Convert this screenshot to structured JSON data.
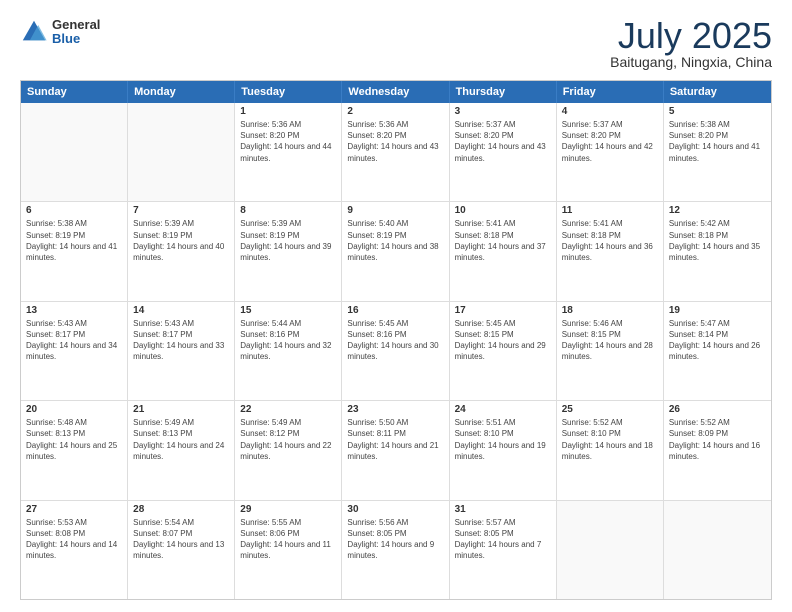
{
  "header": {
    "logo_general": "General",
    "logo_blue": "Blue",
    "title": "July 2025",
    "location": "Baitugang, Ningxia, China"
  },
  "calendar": {
    "days": [
      "Sunday",
      "Monday",
      "Tuesday",
      "Wednesday",
      "Thursday",
      "Friday",
      "Saturday"
    ],
    "weeks": [
      [
        {
          "day": "",
          "info": ""
        },
        {
          "day": "",
          "info": ""
        },
        {
          "day": "1",
          "info": "Sunrise: 5:36 AM\nSunset: 8:20 PM\nDaylight: 14 hours and 44 minutes."
        },
        {
          "day": "2",
          "info": "Sunrise: 5:36 AM\nSunset: 8:20 PM\nDaylight: 14 hours and 43 minutes."
        },
        {
          "day": "3",
          "info": "Sunrise: 5:37 AM\nSunset: 8:20 PM\nDaylight: 14 hours and 43 minutes."
        },
        {
          "day": "4",
          "info": "Sunrise: 5:37 AM\nSunset: 8:20 PM\nDaylight: 14 hours and 42 minutes."
        },
        {
          "day": "5",
          "info": "Sunrise: 5:38 AM\nSunset: 8:20 PM\nDaylight: 14 hours and 41 minutes."
        }
      ],
      [
        {
          "day": "6",
          "info": "Sunrise: 5:38 AM\nSunset: 8:19 PM\nDaylight: 14 hours and 41 minutes."
        },
        {
          "day": "7",
          "info": "Sunrise: 5:39 AM\nSunset: 8:19 PM\nDaylight: 14 hours and 40 minutes."
        },
        {
          "day": "8",
          "info": "Sunrise: 5:39 AM\nSunset: 8:19 PM\nDaylight: 14 hours and 39 minutes."
        },
        {
          "day": "9",
          "info": "Sunrise: 5:40 AM\nSunset: 8:19 PM\nDaylight: 14 hours and 38 minutes."
        },
        {
          "day": "10",
          "info": "Sunrise: 5:41 AM\nSunset: 8:18 PM\nDaylight: 14 hours and 37 minutes."
        },
        {
          "day": "11",
          "info": "Sunrise: 5:41 AM\nSunset: 8:18 PM\nDaylight: 14 hours and 36 minutes."
        },
        {
          "day": "12",
          "info": "Sunrise: 5:42 AM\nSunset: 8:18 PM\nDaylight: 14 hours and 35 minutes."
        }
      ],
      [
        {
          "day": "13",
          "info": "Sunrise: 5:43 AM\nSunset: 8:17 PM\nDaylight: 14 hours and 34 minutes."
        },
        {
          "day": "14",
          "info": "Sunrise: 5:43 AM\nSunset: 8:17 PM\nDaylight: 14 hours and 33 minutes."
        },
        {
          "day": "15",
          "info": "Sunrise: 5:44 AM\nSunset: 8:16 PM\nDaylight: 14 hours and 32 minutes."
        },
        {
          "day": "16",
          "info": "Sunrise: 5:45 AM\nSunset: 8:16 PM\nDaylight: 14 hours and 30 minutes."
        },
        {
          "day": "17",
          "info": "Sunrise: 5:45 AM\nSunset: 8:15 PM\nDaylight: 14 hours and 29 minutes."
        },
        {
          "day": "18",
          "info": "Sunrise: 5:46 AM\nSunset: 8:15 PM\nDaylight: 14 hours and 28 minutes."
        },
        {
          "day": "19",
          "info": "Sunrise: 5:47 AM\nSunset: 8:14 PM\nDaylight: 14 hours and 26 minutes."
        }
      ],
      [
        {
          "day": "20",
          "info": "Sunrise: 5:48 AM\nSunset: 8:13 PM\nDaylight: 14 hours and 25 minutes."
        },
        {
          "day": "21",
          "info": "Sunrise: 5:49 AM\nSunset: 8:13 PM\nDaylight: 14 hours and 24 minutes."
        },
        {
          "day": "22",
          "info": "Sunrise: 5:49 AM\nSunset: 8:12 PM\nDaylight: 14 hours and 22 minutes."
        },
        {
          "day": "23",
          "info": "Sunrise: 5:50 AM\nSunset: 8:11 PM\nDaylight: 14 hours and 21 minutes."
        },
        {
          "day": "24",
          "info": "Sunrise: 5:51 AM\nSunset: 8:10 PM\nDaylight: 14 hours and 19 minutes."
        },
        {
          "day": "25",
          "info": "Sunrise: 5:52 AM\nSunset: 8:10 PM\nDaylight: 14 hours and 18 minutes."
        },
        {
          "day": "26",
          "info": "Sunrise: 5:52 AM\nSunset: 8:09 PM\nDaylight: 14 hours and 16 minutes."
        }
      ],
      [
        {
          "day": "27",
          "info": "Sunrise: 5:53 AM\nSunset: 8:08 PM\nDaylight: 14 hours and 14 minutes."
        },
        {
          "day": "28",
          "info": "Sunrise: 5:54 AM\nSunset: 8:07 PM\nDaylight: 14 hours and 13 minutes."
        },
        {
          "day": "29",
          "info": "Sunrise: 5:55 AM\nSunset: 8:06 PM\nDaylight: 14 hours and 11 minutes."
        },
        {
          "day": "30",
          "info": "Sunrise: 5:56 AM\nSunset: 8:05 PM\nDaylight: 14 hours and 9 minutes."
        },
        {
          "day": "31",
          "info": "Sunrise: 5:57 AM\nSunset: 8:05 PM\nDaylight: 14 hours and 7 minutes."
        },
        {
          "day": "",
          "info": ""
        },
        {
          "day": "",
          "info": ""
        }
      ]
    ]
  }
}
